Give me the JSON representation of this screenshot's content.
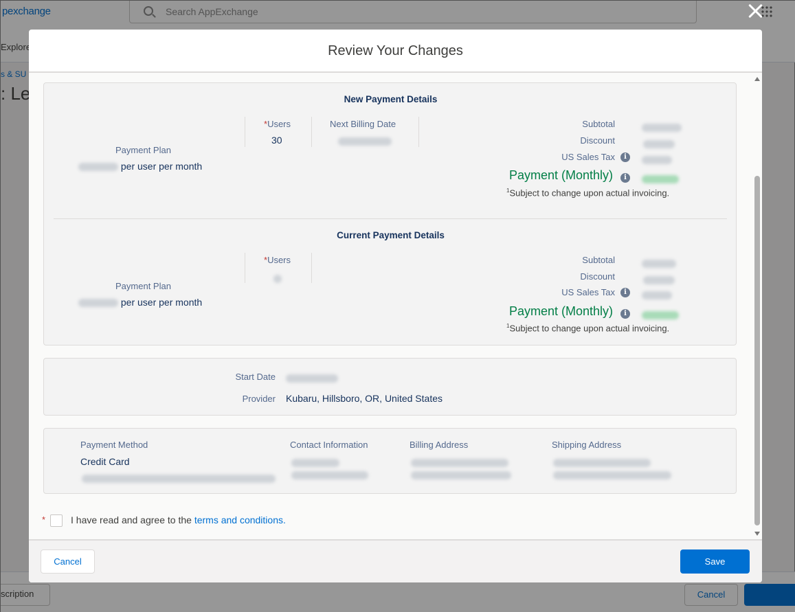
{
  "background": {
    "logo": "pexchange",
    "search_placeholder": "Search AppExchange",
    "nav_explore": "Explore",
    "breadcrumb": "s & SU",
    "page_title": ": Le",
    "footer_left": "scription",
    "footer_cancel": "Cancel"
  },
  "modal": {
    "title": "Review Your Changes",
    "new_payment": {
      "section_title": "New Payment Details",
      "plan_label": "Payment Plan",
      "plan_suffix": "per user per month",
      "users_label": "Users",
      "users_value": "30",
      "billing_label": "Next Billing Date",
      "subtotal_label": "Subtotal",
      "discount_label": "Discount",
      "tax_label": "US Sales Tax",
      "payment_label": "Payment (Monthly)",
      "note_sup": "1",
      "note": "Subject to change upon actual invoicing."
    },
    "current_payment": {
      "section_title": "Current Payment Details",
      "plan_label": "Payment Plan",
      "plan_suffix": "per user per month",
      "users_label": "Users",
      "subtotal_label": "Subtotal",
      "discount_label": "Discount",
      "tax_label": "US Sales Tax",
      "payment_label": "Payment (Monthly)",
      "note_sup": "1",
      "note": "Subject to change upon actual invoicing."
    },
    "details": {
      "start_date_label": "Start Date",
      "provider_label": "Provider",
      "provider_value": "Kubaru, Hillsboro, OR, United States"
    },
    "billing": {
      "payment_method_label": "Payment Method",
      "payment_method_value": "Credit Card",
      "contact_label": "Contact Information",
      "billing_address_label": "Billing Address",
      "shipping_address_label": "Shipping Address"
    },
    "agreement": {
      "text": "I have read and agree to the",
      "link": "terms and conditions."
    },
    "footer": {
      "cancel_label": "Cancel",
      "save_label": "Save"
    }
  },
  "colors": {
    "accent": "#0070d2",
    "payment_green": "#027e46",
    "required": "#c23934"
  }
}
